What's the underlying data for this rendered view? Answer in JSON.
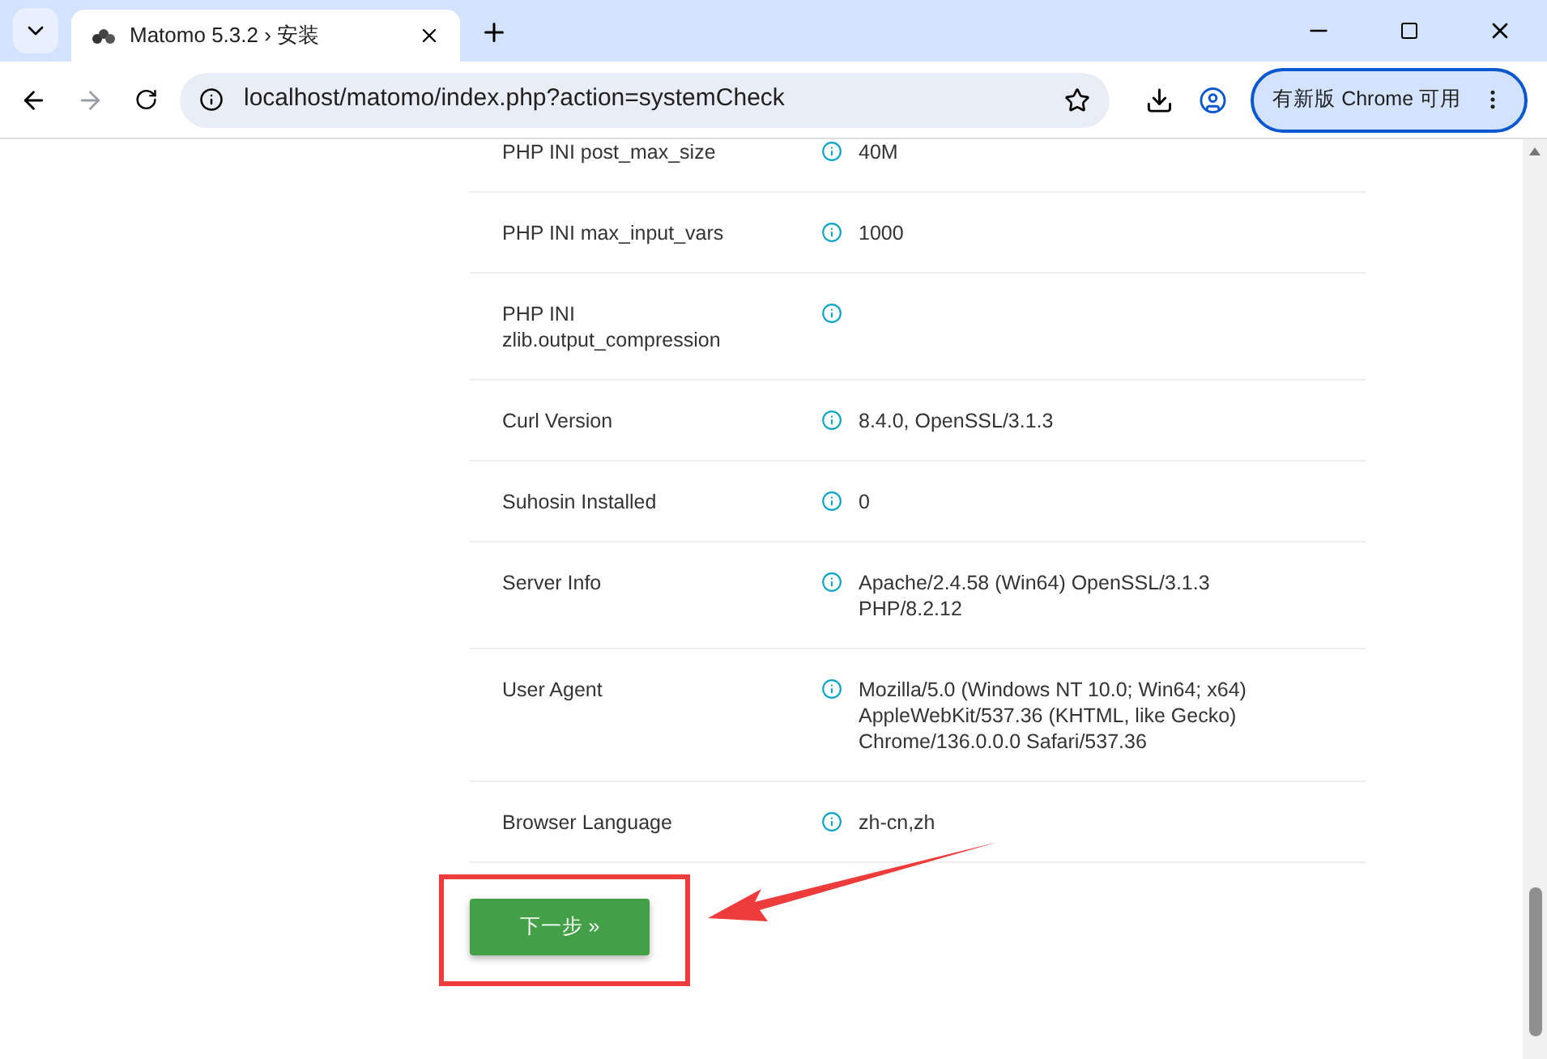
{
  "browser": {
    "tab_title": "Matomo 5.3.2 › 安装",
    "url": "localhost/matomo/index.php?action=systemCheck",
    "update_button": "有新版 Chrome 可用"
  },
  "rows": [
    {
      "label": "PHP INI post_max_size",
      "value": "40M"
    },
    {
      "label": "PHP INI max_input_vars",
      "value": "1000"
    },
    {
      "label": "PHP INI zlib.output_compression",
      "value": ""
    },
    {
      "label": "Curl Version",
      "value": "8.4.0, OpenSSL/3.1.3"
    },
    {
      "label": "Suhosin Installed",
      "value": "0"
    },
    {
      "label": "Server Info",
      "value": "Apache/2.4.58 (Win64) OpenSSL/3.1.3 PHP/8.2.12"
    },
    {
      "label": "User Agent",
      "value": "Mozilla/5.0 (Windows NT 10.0; Win64; x64) AppleWebKit/537.36 (KHTML, like Gecko) Chrome/136.0.0.0 Safari/537.36"
    },
    {
      "label": "Browser Language",
      "value": "zh-cn,zh"
    }
  ],
  "next_button": "下一步 »",
  "annotations": {
    "highlight_frame": true,
    "arrow": true
  }
}
